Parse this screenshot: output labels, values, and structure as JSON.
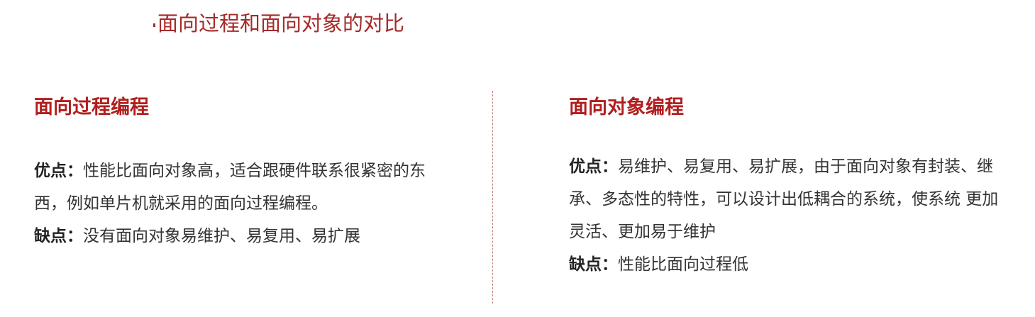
{
  "page": {
    "title": "面向过程和面向对象的对比",
    "accent_color": "#a52a2a"
  },
  "left": {
    "heading": "面向过程编程",
    "pros_label": "优点：",
    "pros_text": "性能比面向对象高，适合跟硬件联系很紧密的东西，例如单片机就采用的面向过程编程。",
    "cons_label": "缺点：",
    "cons_text": "没有面向对象易维护、易复用、易扩展"
  },
  "right": {
    "heading": "面向对象编程",
    "pros_label": "优点：",
    "pros_text": "易维护、易复用、易扩展，由于面向对象有封装、继承、多态性的特性，可以设计出低耦合的系统，使系统 更加灵活、更加易于维护",
    "cons_label": "缺点：",
    "cons_text": "性能比面向过程低"
  }
}
